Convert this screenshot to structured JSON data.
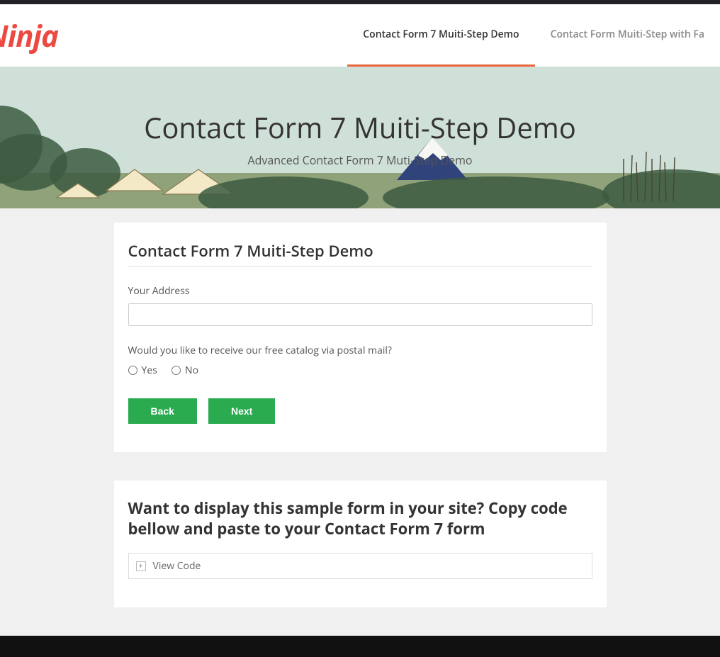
{
  "logo": "Ninja",
  "nav": {
    "items": [
      {
        "label": "Contact Form 7 Muiti-Step Demo",
        "active": true
      },
      {
        "label": "Contact Form Muiti-Step with Fa",
        "active": false
      }
    ]
  },
  "hero": {
    "title": "Contact Form 7 Muiti-Step Demo",
    "subtitle": "Advanced Contact Form 7 Muti-Step Demo"
  },
  "form": {
    "title": "Contact Form 7 Muiti-Step Demo",
    "address_label": "Your Address",
    "address_value": "",
    "catalog_question": "Would you like to receive our free catalog via postal mail?",
    "radio_options": [
      "Yes",
      "No"
    ],
    "back_label": "Back",
    "next_label": "Next"
  },
  "codebox": {
    "title": "Want to display this sample form in your site? Copy code bellow and paste to your Contact Form 7 form",
    "toggle_label": "View Code"
  }
}
